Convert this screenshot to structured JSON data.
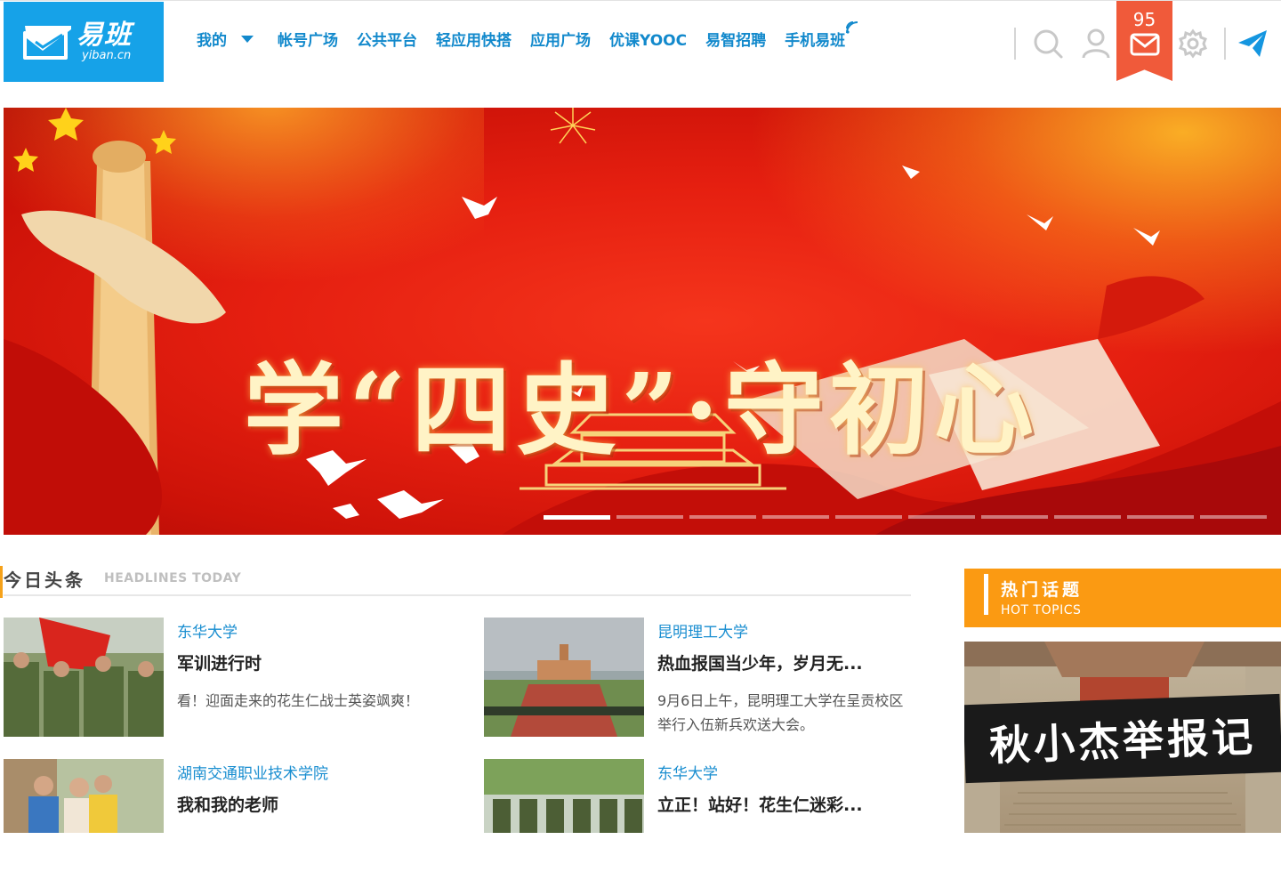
{
  "logo": {
    "name_cn": "易班",
    "domain": "yiban.cn"
  },
  "nav": [
    {
      "label": "我的",
      "dropdown": true
    },
    {
      "label": "帐号广场"
    },
    {
      "label": "公共平台"
    },
    {
      "label": "轻应用快搭"
    },
    {
      "label": "应用广场"
    },
    {
      "label": "优课YOOC"
    },
    {
      "label": "易智招聘"
    },
    {
      "label": "手机易班"
    }
  ],
  "toolbar": {
    "icons": [
      "search-icon",
      "user-icon",
      "mail-icon",
      "gear-icon",
      "send-icon"
    ],
    "mail_count": "95"
  },
  "banner": {
    "title": "学“四史”·守初心",
    "slide_count": 10,
    "active_slide": 1
  },
  "headlines": {
    "title": "今日头条",
    "subtitle": "HEADLINES TODAY",
    "items": [
      {
        "school": "东华大学",
        "title": "军训进行时",
        "desc": "看！迎面走来的花生仁战士英姿飒爽！"
      },
      {
        "school": "昆明理工大学",
        "title": "热血报国当少年，岁月无...",
        "desc": "9月6日上午，昆明理工大学在呈贡校区举行入伍新兵欢送大会。"
      },
      {
        "school": "湖南交通职业技术学院",
        "title": "我和我的老师",
        "desc": ""
      },
      {
        "school": "东华大学",
        "title": "立正！站好！花生仁迷彩...",
        "desc": ""
      }
    ]
  },
  "hot_topics": {
    "title": "热门话题",
    "subtitle": "HOT TOPICS",
    "feature_caption": "秋小杰举报记"
  },
  "colors": {
    "brand_blue": "#16a2e8",
    "nav_blue": "#1289cc",
    "mail_red": "#f05a3a",
    "hot_orange": "#fb9a12",
    "accent_orange": "#f6a21a"
  }
}
